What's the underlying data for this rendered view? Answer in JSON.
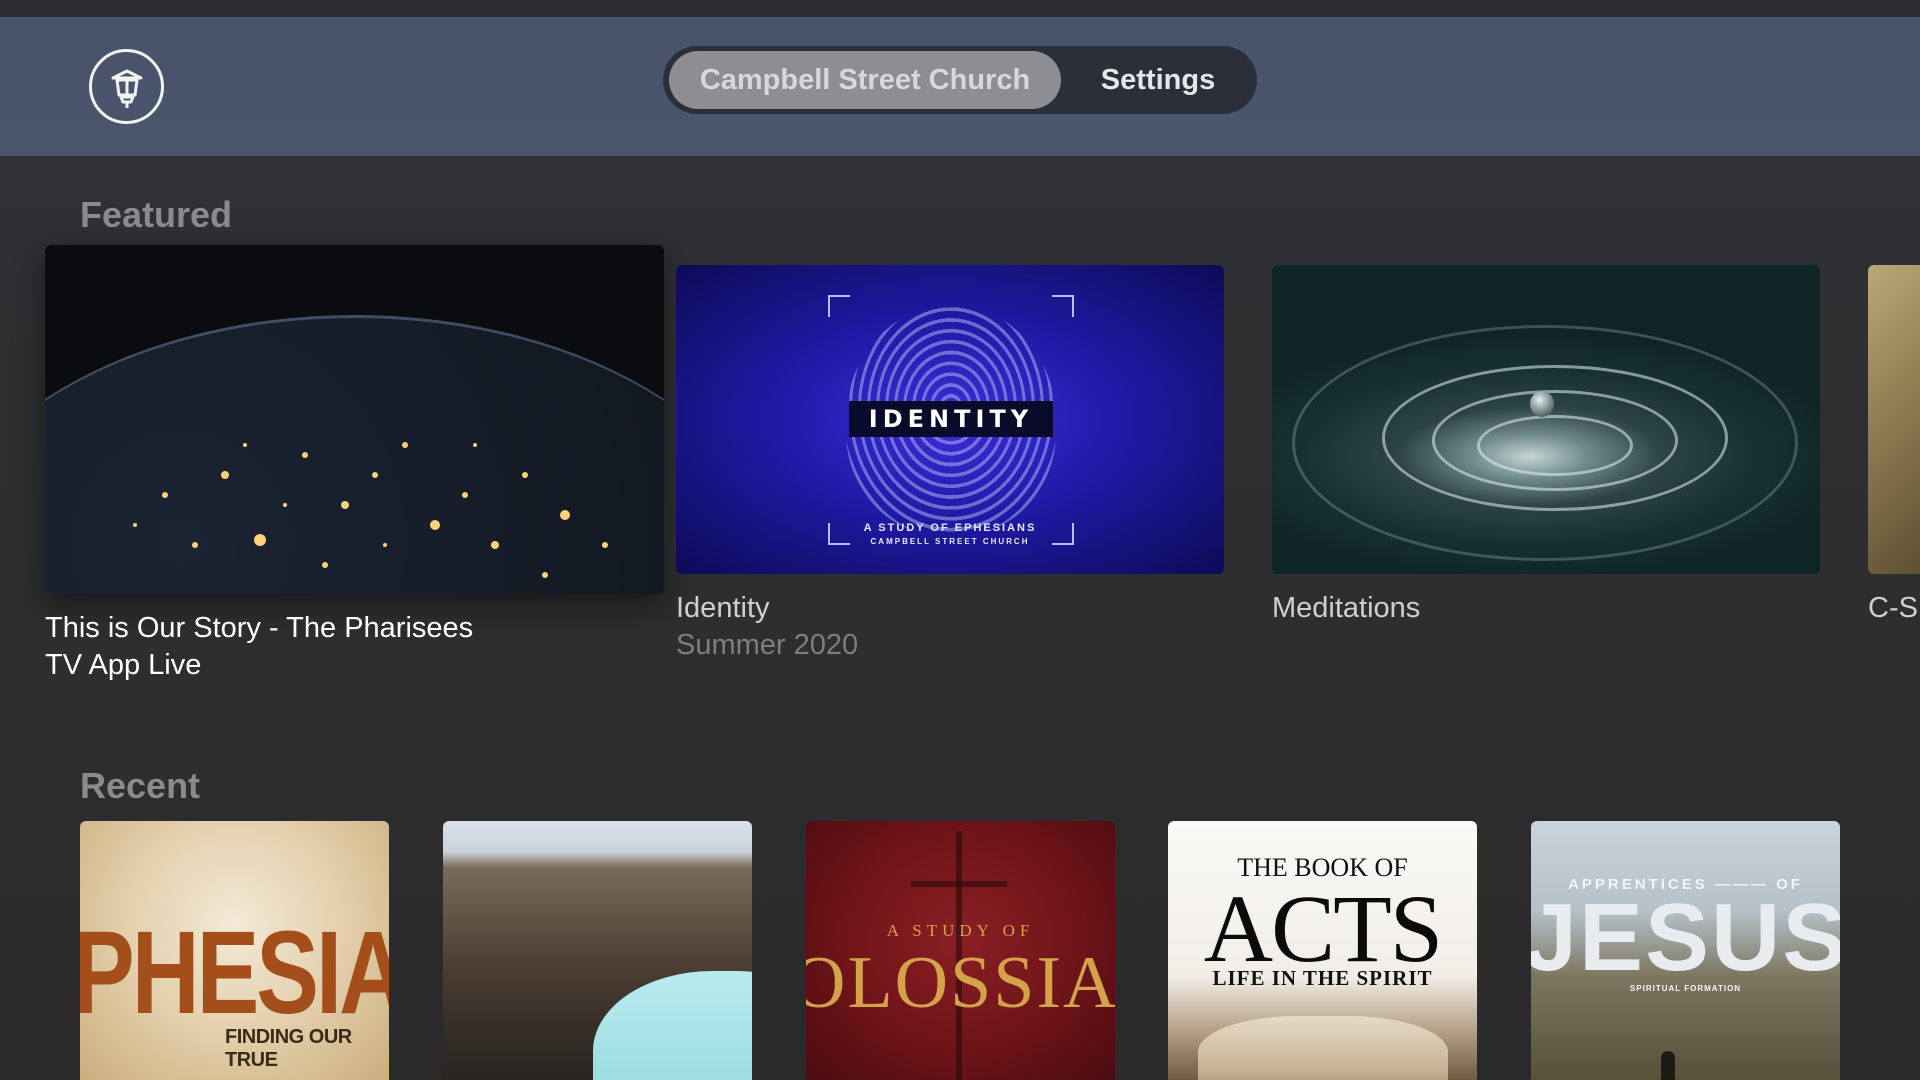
{
  "header": {
    "logo": "lantern-icon",
    "tabs": [
      {
        "label": "Campbell Street Church",
        "selected": true
      },
      {
        "label": "Settings",
        "selected": false
      }
    ]
  },
  "featured": {
    "title": "Featured",
    "items": [
      {
        "title": "This is Our Story - The Pharisees",
        "subtitle": "TV App Live",
        "focused": true
      },
      {
        "title": "Identity",
        "subtitle": "Summer 2020",
        "artwork_text": "IDENTITY",
        "artwork_sub": "A STUDY OF EPHESIANS",
        "artwork_sub2": "CAMPBELL STREET CHURCH"
      },
      {
        "title": "Meditations",
        "subtitle": ""
      },
      {
        "title": "C-S",
        "subtitle": ""
      }
    ]
  },
  "recent": {
    "title": "Recent",
    "items": [
      {
        "artwork_text": "PHESIAN",
        "artwork_sub": "FINDING OUR TRUE"
      },
      {
        "artwork_text": ""
      },
      {
        "artwork_small": "A STUDY OF",
        "artwork_text": "OLOSSIAN"
      },
      {
        "artwork_top": "THE BOOK OF",
        "artwork_text": "ACTS",
        "artwork_sub": "LIFE IN THE SPIRIT"
      },
      {
        "artwork_top": "APPRENTICES ——— OF",
        "artwork_text": "JESUS",
        "artwork_sub": "SPIRITUAL FORMATION"
      }
    ]
  },
  "colors": {
    "header_bg": "#4a566d",
    "page_bg": "#2f2f31",
    "tab_selected_bg": "#8c8e92",
    "identity_blue": "#2a22c4",
    "ephesians_orange": "#a44e1b",
    "colossians_red": "#7a171c"
  }
}
